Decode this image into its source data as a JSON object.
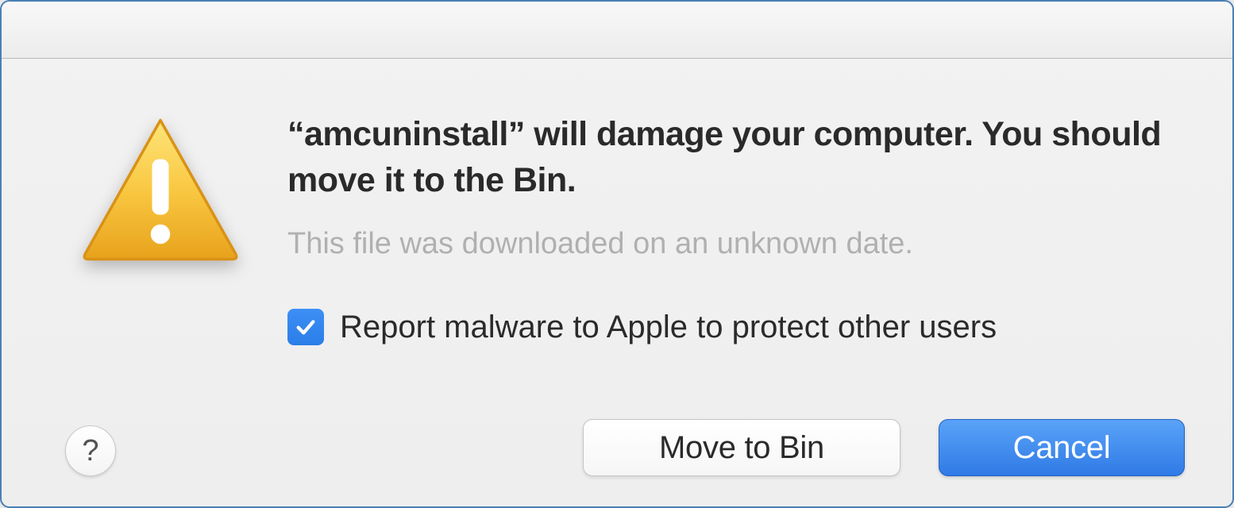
{
  "dialog": {
    "headline": "“amcuninstall” will damage your computer. You should move it to the Bin.",
    "subtext": "This file was downloaded on an unknown date.",
    "checkbox": {
      "checked": true,
      "label": "Report malware to Apple to protect other users"
    },
    "buttons": {
      "secondary": "Move to Bin",
      "primary": "Cancel"
    },
    "help": "?"
  }
}
